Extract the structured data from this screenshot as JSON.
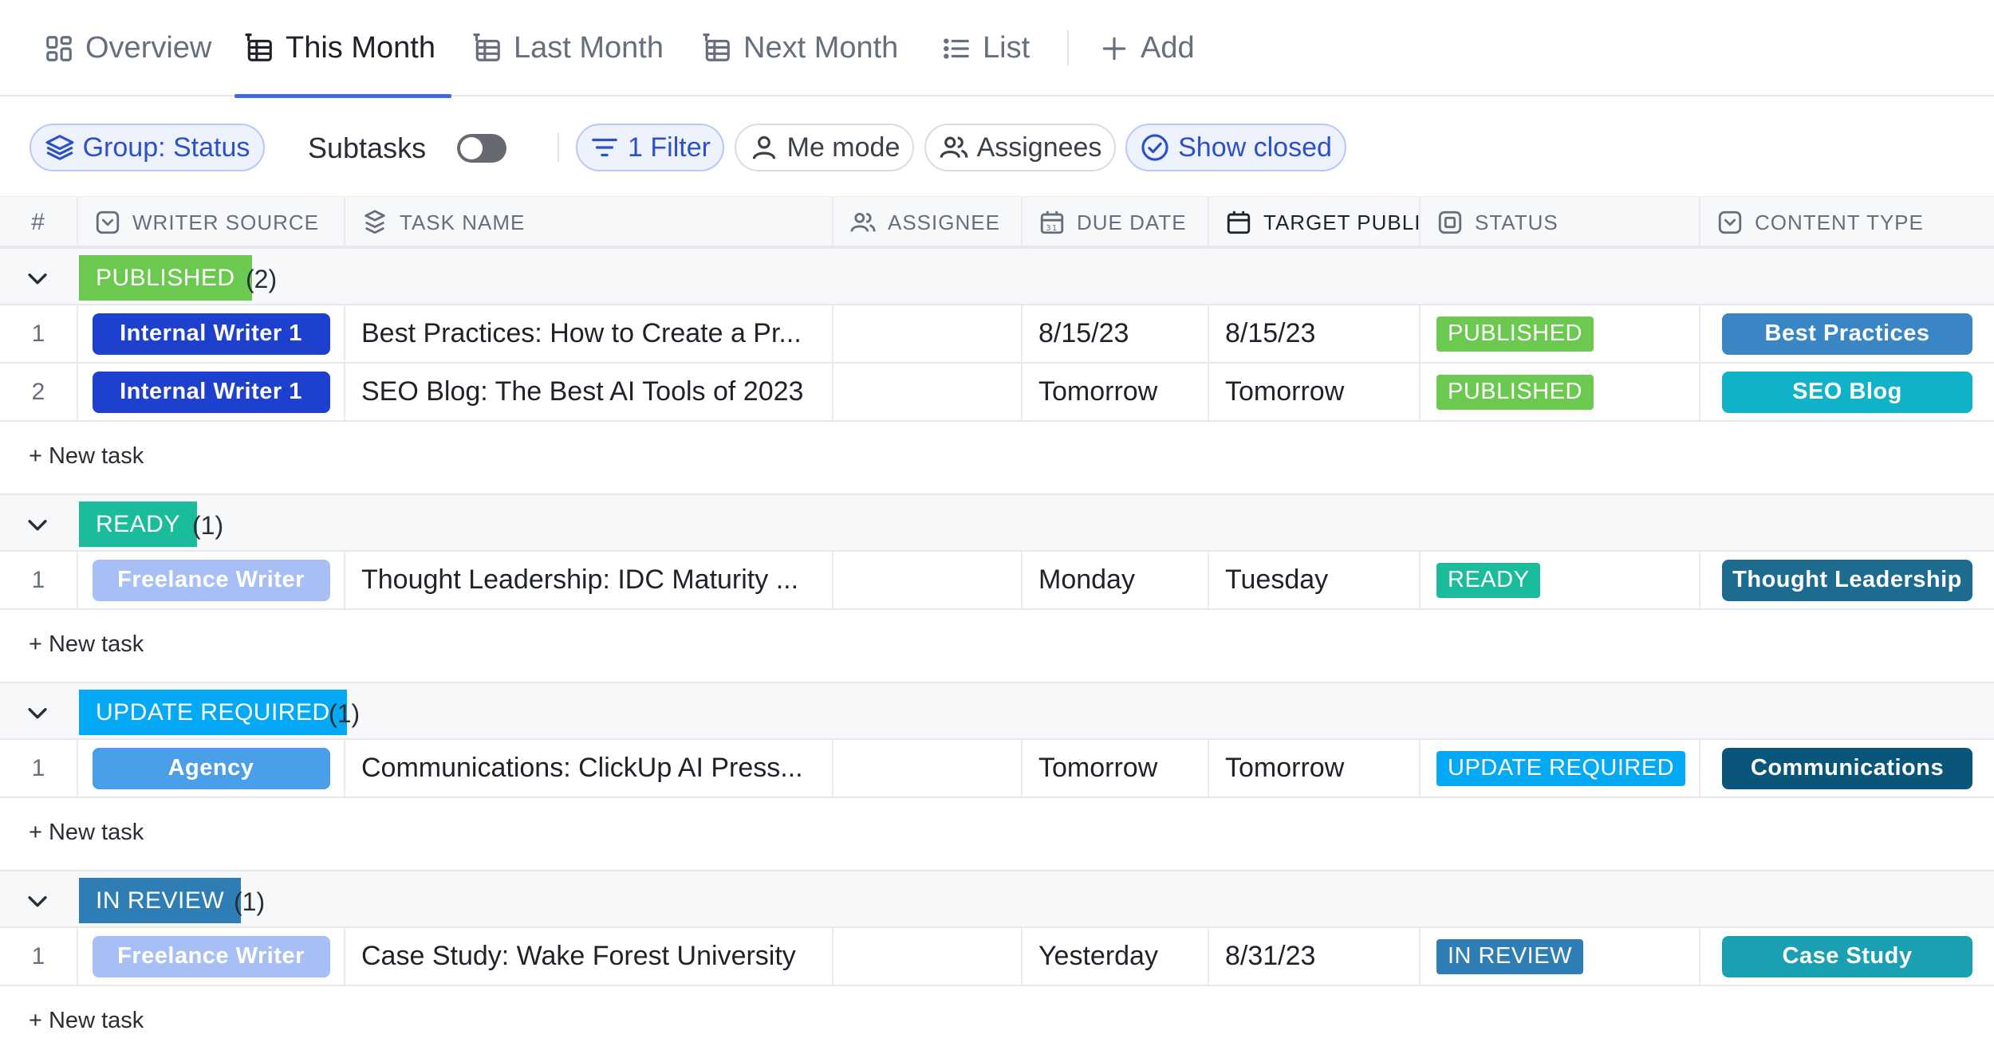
{
  "tabs": [
    {
      "label": "Overview"
    },
    {
      "label": "This Month"
    },
    {
      "label": "Last Month"
    },
    {
      "label": "Next Month"
    },
    {
      "label": "List"
    },
    {
      "label": "Add"
    }
  ],
  "active_tab": "This Month",
  "toolbar": {
    "group": "Group: Status",
    "subtasks": "Subtasks",
    "subtasks_enabled": false,
    "filter": "1 Filter",
    "me_mode": "Me mode",
    "assignees": "Assignees",
    "show_closed": "Show closed"
  },
  "columns": {
    "num": "#",
    "writer_source": "WRITER SOURCE",
    "task_name": "TASK NAME",
    "assignee": "ASSIGNEE",
    "due_date": "DUE DATE",
    "target": "TARGET PUBLI",
    "status": "STATUS",
    "content_type": "CONTENT TYPE"
  },
  "new_task_label": "+ New task",
  "colors": {
    "published": "#6bc950",
    "ready": "#1bbc9c",
    "update_required": "#03a9f4",
    "in_review": "#2e7db5",
    "internal_writer": "#1e40cf",
    "freelance_writer": "#a7bff5",
    "agency": "#4a9fe8",
    "accent": "#4169e1"
  },
  "groups": [
    {
      "status": "PUBLISHED",
      "count": "(2)",
      "tasks": [
        {
          "num": "1",
          "writer": "Internal Writer 1",
          "task": "Best Practices: How to Create a Pr...",
          "due": "8/15/23",
          "target": "8/15/23",
          "status": "PUBLISHED",
          "content_type": "Best Practices"
        },
        {
          "num": "2",
          "writer": "Internal Writer 1",
          "task": "SEO Blog: The Best AI Tools of 2023",
          "due": "Tomorrow",
          "target": "Tomorrow",
          "status": "PUBLISHED",
          "content_type": "SEO Blog"
        }
      ]
    },
    {
      "status": "READY",
      "count": "(1)",
      "tasks": [
        {
          "num": "1",
          "writer": "Freelance Writer",
          "task": "Thought Leadership: IDC Maturity ...",
          "due": "Monday",
          "target": "Tuesday",
          "status": "READY",
          "content_type": "Thought Leadership"
        }
      ]
    },
    {
      "status": "UPDATE REQUIRED",
      "count": "(1)",
      "tasks": [
        {
          "num": "1",
          "writer": "Agency",
          "task": "Communications: ClickUp AI Press...",
          "due": "Tomorrow",
          "target": "Tomorrow",
          "status": "UPDATE REQUIRED",
          "content_type": "Communications"
        }
      ]
    },
    {
      "status": "IN REVIEW",
      "count": "(1)",
      "tasks": [
        {
          "num": "1",
          "writer": "Freelance Writer",
          "task": "Case Study: Wake Forest University",
          "due": "Yesterday",
          "target": "8/31/23",
          "status": "IN REVIEW",
          "content_type": "Case Study"
        }
      ]
    }
  ]
}
